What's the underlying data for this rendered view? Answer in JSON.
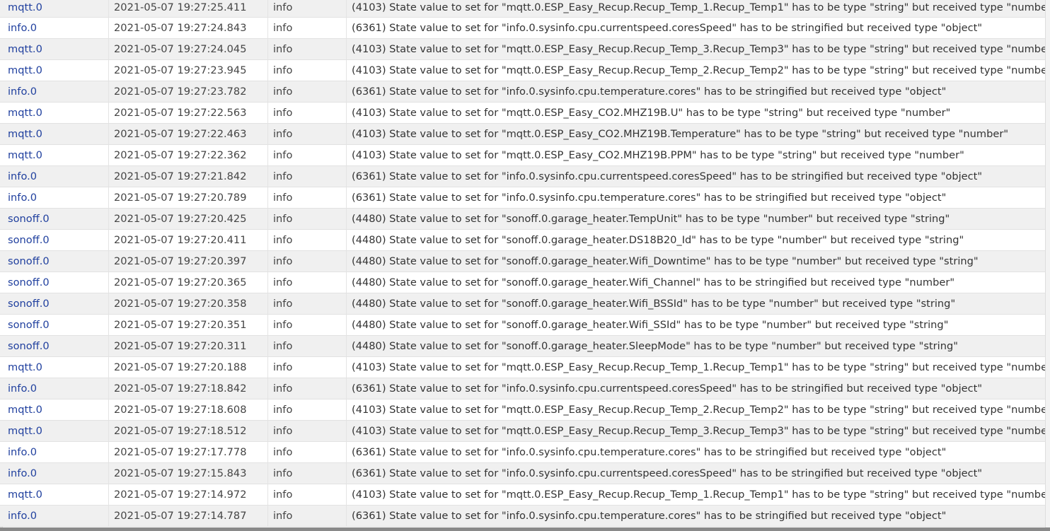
{
  "log": {
    "rows": [
      {
        "source": "mqtt.0",
        "time": "2021-05-07 19:27:25.411",
        "level": "info",
        "message": "(4103) State value to set for \"mqtt.0.ESP_Easy_Recup.Recup_Temp_1.Recup_Temp1\" has to be type \"string\" but received type \"number\""
      },
      {
        "source": "info.0",
        "time": "2021-05-07 19:27:24.843",
        "level": "info",
        "message": "(6361) State value to set for \"info.0.sysinfo.cpu.currentspeed.coresSpeed\" has to be stringified but received type \"object\""
      },
      {
        "source": "mqtt.0",
        "time": "2021-05-07 19:27:24.045",
        "level": "info",
        "message": "(4103) State value to set for \"mqtt.0.ESP_Easy_Recup.Recup_Temp_3.Recup_Temp3\" has to be type \"string\" but received type \"number\""
      },
      {
        "source": "mqtt.0",
        "time": "2021-05-07 19:27:23.945",
        "level": "info",
        "message": "(4103) State value to set for \"mqtt.0.ESP_Easy_Recup.Recup_Temp_2.Recup_Temp2\" has to be type \"string\" but received type \"number\""
      },
      {
        "source": "info.0",
        "time": "2021-05-07 19:27:23.782",
        "level": "info",
        "message": "(6361) State value to set for \"info.0.sysinfo.cpu.temperature.cores\" has to be stringified but received type \"object\""
      },
      {
        "source": "mqtt.0",
        "time": "2021-05-07 19:27:22.563",
        "level": "info",
        "message": "(4103) State value to set for \"mqtt.0.ESP_Easy_CO2.MHZ19B.U\" has to be type \"string\" but received type \"number\""
      },
      {
        "source": "mqtt.0",
        "time": "2021-05-07 19:27:22.463",
        "level": "info",
        "message": "(4103) State value to set for \"mqtt.0.ESP_Easy_CO2.MHZ19B.Temperature\" has to be type \"string\" but received type \"number\""
      },
      {
        "source": "mqtt.0",
        "time": "2021-05-07 19:27:22.362",
        "level": "info",
        "message": "(4103) State value to set for \"mqtt.0.ESP_Easy_CO2.MHZ19B.PPM\" has to be type \"string\" but received type \"number\""
      },
      {
        "source": "info.0",
        "time": "2021-05-07 19:27:21.842",
        "level": "info",
        "message": "(6361) State value to set for \"info.0.sysinfo.cpu.currentspeed.coresSpeed\" has to be stringified but received type \"object\""
      },
      {
        "source": "info.0",
        "time": "2021-05-07 19:27:20.789",
        "level": "info",
        "message": "(6361) State value to set for \"info.0.sysinfo.cpu.temperature.cores\" has to be stringified but received type \"object\""
      },
      {
        "source": "sonoff.0",
        "time": "2021-05-07 19:27:20.425",
        "level": "info",
        "message": "(4480) State value to set for \"sonoff.0.garage_heater.TempUnit\" has to be type \"number\" but received type \"string\""
      },
      {
        "source": "sonoff.0",
        "time": "2021-05-07 19:27:20.411",
        "level": "info",
        "message": "(4480) State value to set for \"sonoff.0.garage_heater.DS18B20_Id\" has to be type \"number\" but received type \"string\""
      },
      {
        "source": "sonoff.0",
        "time": "2021-05-07 19:27:20.397",
        "level": "info",
        "message": "(4480) State value to set for \"sonoff.0.garage_heater.Wifi_Downtime\" has to be type \"number\" but received type \"string\""
      },
      {
        "source": "sonoff.0",
        "time": "2021-05-07 19:27:20.365",
        "level": "info",
        "message": "(4480) State value to set for \"sonoff.0.garage_heater.Wifi_Channel\" has to be stringified but received type \"number\""
      },
      {
        "source": "sonoff.0",
        "time": "2021-05-07 19:27:20.358",
        "level": "info",
        "message": "(4480) State value to set for \"sonoff.0.garage_heater.Wifi_BSSId\" has to be type \"number\" but received type \"string\""
      },
      {
        "source": "sonoff.0",
        "time": "2021-05-07 19:27:20.351",
        "level": "info",
        "message": "(4480) State value to set for \"sonoff.0.garage_heater.Wifi_SSId\" has to be type \"number\" but received type \"string\""
      },
      {
        "source": "sonoff.0",
        "time": "2021-05-07 19:27:20.311",
        "level": "info",
        "message": "(4480) State value to set for \"sonoff.0.garage_heater.SleepMode\" has to be type \"number\" but received type \"string\""
      },
      {
        "source": "mqtt.0",
        "time": "2021-05-07 19:27:20.188",
        "level": "info",
        "message": "(4103) State value to set for \"mqtt.0.ESP_Easy_Recup.Recup_Temp_1.Recup_Temp1\" has to be type \"string\" but received type \"number\""
      },
      {
        "source": "info.0",
        "time": "2021-05-07 19:27:18.842",
        "level": "info",
        "message": "(6361) State value to set for \"info.0.sysinfo.cpu.currentspeed.coresSpeed\" has to be stringified but received type \"object\""
      },
      {
        "source": "mqtt.0",
        "time": "2021-05-07 19:27:18.608",
        "level": "info",
        "message": "(4103) State value to set for \"mqtt.0.ESP_Easy_Recup.Recup_Temp_2.Recup_Temp2\" has to be type \"string\" but received type \"number\""
      },
      {
        "source": "mqtt.0",
        "time": "2021-05-07 19:27:18.512",
        "level": "info",
        "message": "(4103) State value to set for \"mqtt.0.ESP_Easy_Recup.Recup_Temp_3.Recup_Temp3\" has to be type \"string\" but received type \"number\""
      },
      {
        "source": "info.0",
        "time": "2021-05-07 19:27:17.778",
        "level": "info",
        "message": "(6361) State value to set for \"info.0.sysinfo.cpu.temperature.cores\" has to be stringified but received type \"object\""
      },
      {
        "source": "info.0",
        "time": "2021-05-07 19:27:15.843",
        "level": "info",
        "message": "(6361) State value to set for \"info.0.sysinfo.cpu.currentspeed.coresSpeed\" has to be stringified but received type \"object\""
      },
      {
        "source": "mqtt.0",
        "time": "2021-05-07 19:27:14.972",
        "level": "info",
        "message": "(4103) State value to set for \"mqtt.0.ESP_Easy_Recup.Recup_Temp_1.Recup_Temp1\" has to be type \"string\" but received type \"number\""
      },
      {
        "source": "info.0",
        "time": "2021-05-07 19:27:14.787",
        "level": "info",
        "message": "(6361) State value to set for \"info.0.sysinfo.cpu.temperature.cores\" has to be stringified but received type \"object\""
      }
    ]
  }
}
